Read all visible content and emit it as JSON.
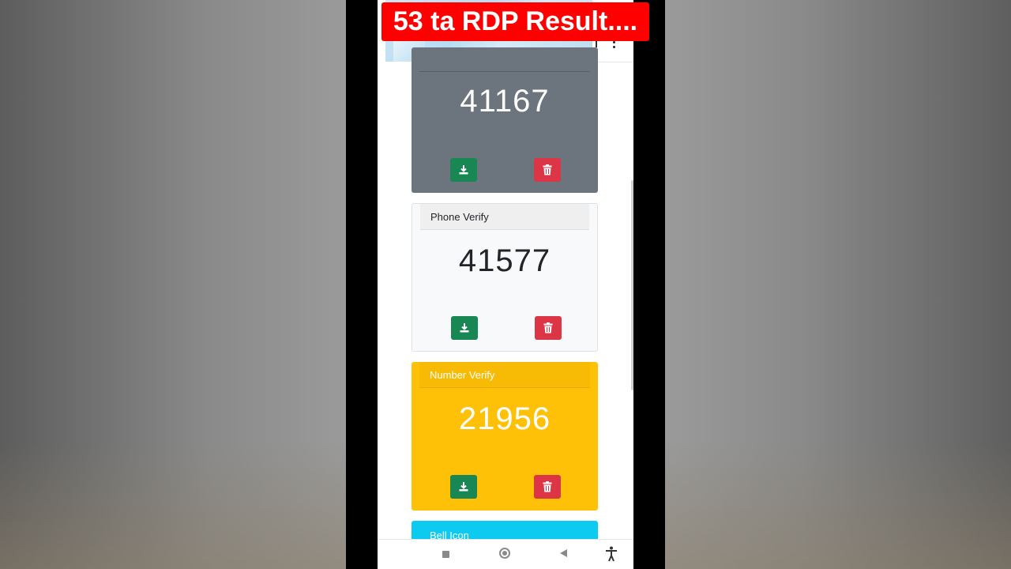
{
  "banner": {
    "text": "53 ta RDP Result...."
  },
  "cards": [
    {
      "label": "",
      "value": "41167",
      "color": "#6c757d"
    },
    {
      "label": "Phone Verify",
      "value": "41577",
      "color": "#f8f9fa"
    },
    {
      "label": "Number Verify",
      "value": "21956",
      "color": "#ffc107"
    },
    {
      "label": "Bell Icon",
      "value": "",
      "color": "#0dcaf0"
    }
  ],
  "buttons": {
    "download_color": "#198754",
    "delete_color": "#dc3545"
  },
  "icons": {
    "download": "download-icon",
    "delete": "trash-icon",
    "menu": "kebab-menu-icon"
  }
}
